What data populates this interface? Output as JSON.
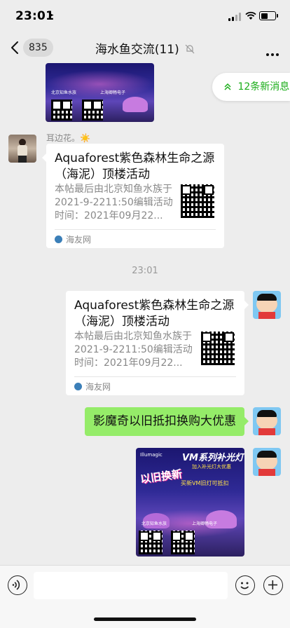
{
  "status_bar": {
    "time": "23:01"
  },
  "nav": {
    "back_count": "835",
    "title": "海水鱼交流(11)"
  },
  "new_messages": {
    "label": "12条新消息"
  },
  "messages": {
    "incoming_sender": "耳边花。☀️",
    "incoming_card": {
      "title": "Aquaforest紫色森林生命之源（海泥）顶楼活动",
      "desc": "本帖最后由北京知鱼水族于2021-9-2211:50编辑活动时间：2021年09月22...",
      "source": "海友网"
    },
    "timestamp": "23:01",
    "outgoing_card": {
      "title": "Aquaforest紫色森林生命之源（海泥）顶楼活动",
      "desc": "本帖最后由北京知鱼水族于2021-9-2211:50编辑活动时间：2021年09月22...",
      "source": "海友网"
    },
    "outgoing_text": "影魔奇以旧抵扣换购大优惠",
    "poster": {
      "brand": "Illumagic",
      "headline": "VM系列补光灯",
      "subhead": "加入补光灯大优惠",
      "badge": "以旧换新",
      "offer": "买新VM旧灯可抵扣",
      "shop_left": "北京知鱼水族",
      "shop_right": "上海卿畅电子"
    },
    "top_poster": {
      "shop_left": "北京知鱼水族",
      "shop_right": "上海卿畅电子"
    }
  },
  "input_bar": {
    "placeholder": ""
  },
  "colors": {
    "background": "#ededed",
    "bubble_green": "#95ec69",
    "accent_green": "#1aad19"
  }
}
